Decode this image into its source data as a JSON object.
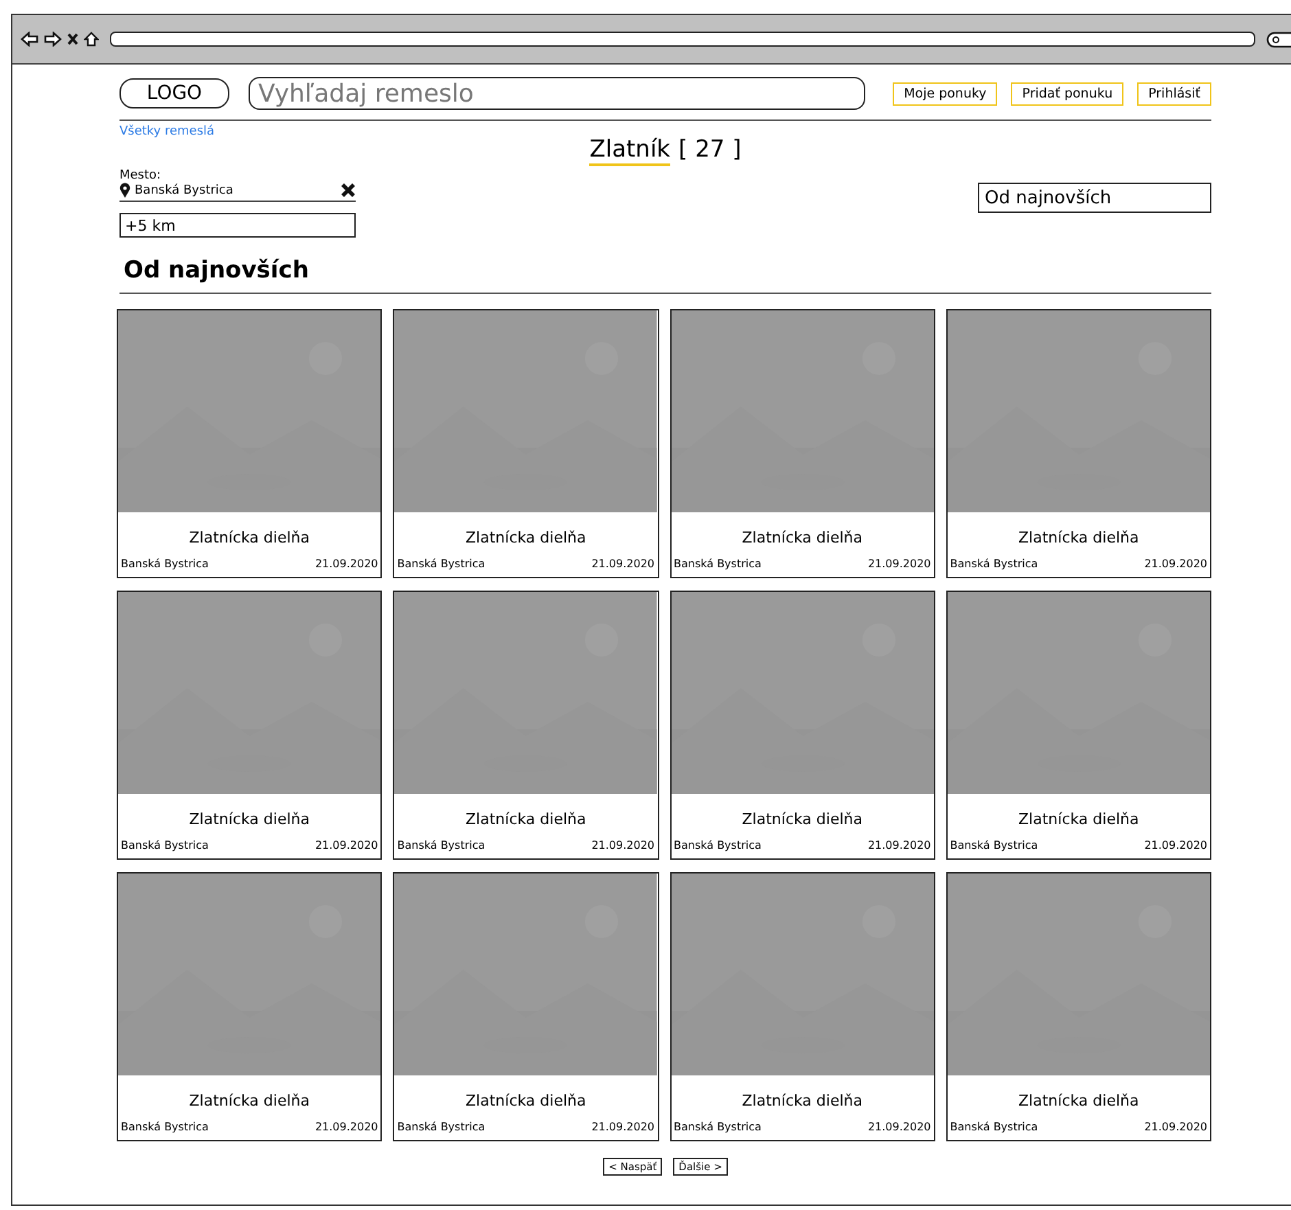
{
  "header": {
    "logo": "LOGO",
    "search": {
      "placeholder": "Vyhľadaj remeslo"
    },
    "buttons": [
      "Moje ponuky",
      "Pridať ponuku",
      "Prihlásiť"
    ]
  },
  "breadcrumb": "Všetky remeslá",
  "category": {
    "title": "Zlatník",
    "count": "[ 27 ]"
  },
  "filters": {
    "city_label": "Mesto:",
    "city": "Banská Bystrica",
    "distance": "+5 km",
    "sort": "Od najnovších"
  },
  "section_heading": "Od najnovších",
  "listings": [
    {
      "title": "Zlatnícka dielňa",
      "city": "Banská Bystrica",
      "date": "21.09.2020"
    },
    {
      "title": "Zlatnícka dielňa",
      "city": "Banská Bystrica",
      "date": "21.09.2020"
    },
    {
      "title": "Zlatnícka dielňa",
      "city": "Banská Bystrica",
      "date": "21.09.2020"
    },
    {
      "title": "Zlatnícka dielňa",
      "city": "Banská Bystrica",
      "date": "21.09.2020"
    },
    {
      "title": "Zlatnícka dielňa",
      "city": "Banská Bystrica",
      "date": "21.09.2020"
    },
    {
      "title": "Zlatnícka dielňa",
      "city": "Banská Bystrica",
      "date": "21.09.2020"
    },
    {
      "title": "Zlatnícka dielňa",
      "city": "Banská Bystrica",
      "date": "21.09.2020"
    },
    {
      "title": "Zlatnícka dielňa",
      "city": "Banská Bystrica",
      "date": "21.09.2020"
    },
    {
      "title": "Zlatnícka dielňa",
      "city": "Banská Bystrica",
      "date": "21.09.2020"
    },
    {
      "title": "Zlatnícka dielňa",
      "city": "Banská Bystrica",
      "date": "21.09.2020"
    },
    {
      "title": "Zlatnícka dielňa",
      "city": "Banská Bystrica",
      "date": "21.09.2020"
    },
    {
      "title": "Zlatnícka dielňa",
      "city": "Banská Bystrica",
      "date": "21.09.2020"
    }
  ],
  "pagination": [
    "< Naspäť",
    "Ďalšie >"
  ]
}
